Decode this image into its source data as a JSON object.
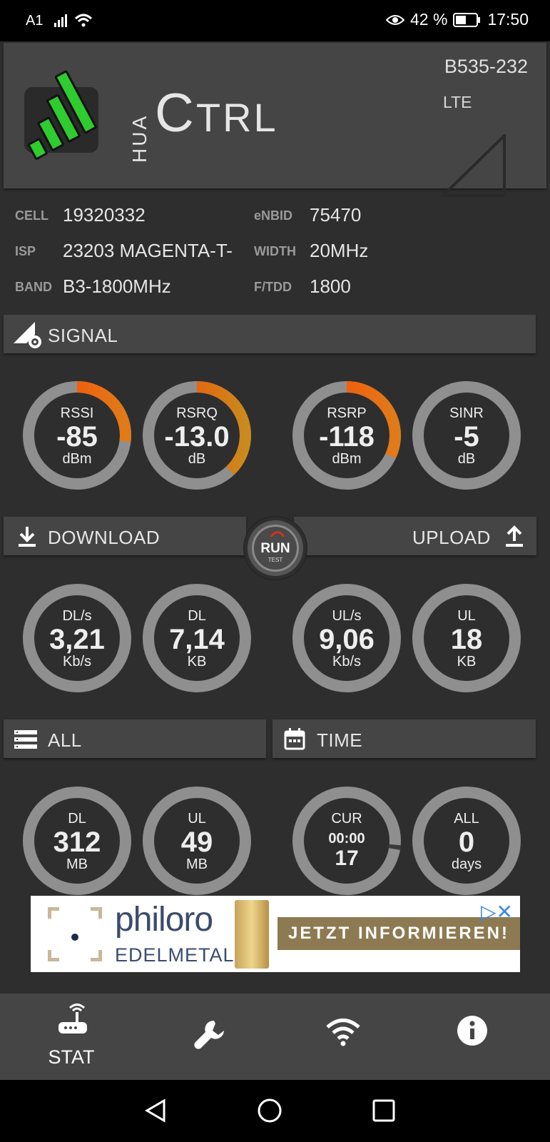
{
  "status_bar": {
    "carrier": "A1",
    "battery": "42 %",
    "time": "17:50"
  },
  "header": {
    "logo_small": "HUA",
    "logo_big_first": "C",
    "logo_big_rest": "TRL",
    "model": "B535-232",
    "network": "LTE"
  },
  "info": {
    "cell_label": "CELL",
    "cell_value": "19320332",
    "enbid_label": "eNBID",
    "enbid_value": "75470",
    "isp_label": "ISP",
    "isp_value": "23203 MAGENTA-T-",
    "width_label": "WIDTH",
    "width_value": "20MHz",
    "band_label": "BAND",
    "band_value": "B3-1800MHz",
    "ftdd_label": "F/TDD",
    "ftdd_value": "1800"
  },
  "signal": {
    "title": "SIGNAL",
    "rssi": {
      "label": "RSSI",
      "value": "-85",
      "unit": "dBm",
      "level": 0.27
    },
    "rsrq": {
      "label": "RSRQ",
      "value": "-13.0",
      "unit": "dB",
      "level": 0.38
    },
    "rsrp": {
      "label": "RSRP",
      "value": "-118",
      "unit": "dBm",
      "level": 0.32
    },
    "sinr": {
      "label": "SINR",
      "value": "-5",
      "unit": "dB",
      "level": 0.0
    }
  },
  "speed": {
    "download_title": "DOWNLOAD",
    "upload_title": "UPLOAD",
    "run_label": "RUN",
    "run_sub": "TEST",
    "dl_rate": {
      "label": "DL/s",
      "value": "3,21",
      "unit": "Kb/s"
    },
    "dl_total": {
      "label": "DL",
      "value": "7,14",
      "unit": "KB"
    },
    "ul_rate": {
      "label": "UL/s",
      "value": "9,06",
      "unit": "Kb/s"
    },
    "ul_total": {
      "label": "UL",
      "value": "18",
      "unit": "KB"
    }
  },
  "totals": {
    "all_title": "ALL",
    "time_title": "TIME",
    "dl": {
      "label": "DL",
      "value": "312",
      "unit": "MB"
    },
    "ul": {
      "label": "UL",
      "value": "49",
      "unit": "MB"
    },
    "cur": {
      "label": "CUR",
      "value": "00:00",
      "value2": "17",
      "level": 0.27
    },
    "all": {
      "label": "ALL",
      "value": "0",
      "unit": "days"
    }
  },
  "ad": {
    "brand": "philoro",
    "sub": "EDELMETALLE",
    "cta": "JETZT INFORMIEREN!"
  },
  "nav": {
    "stat_label": "STAT"
  },
  "colors": {
    "gauge_track": "#8f8f8f",
    "gauge_red": "#ff4500",
    "gauge_orange": "#e07b1a",
    "gauge_amber": "#c98a1e",
    "logo_green": "#2ecc2e"
  }
}
